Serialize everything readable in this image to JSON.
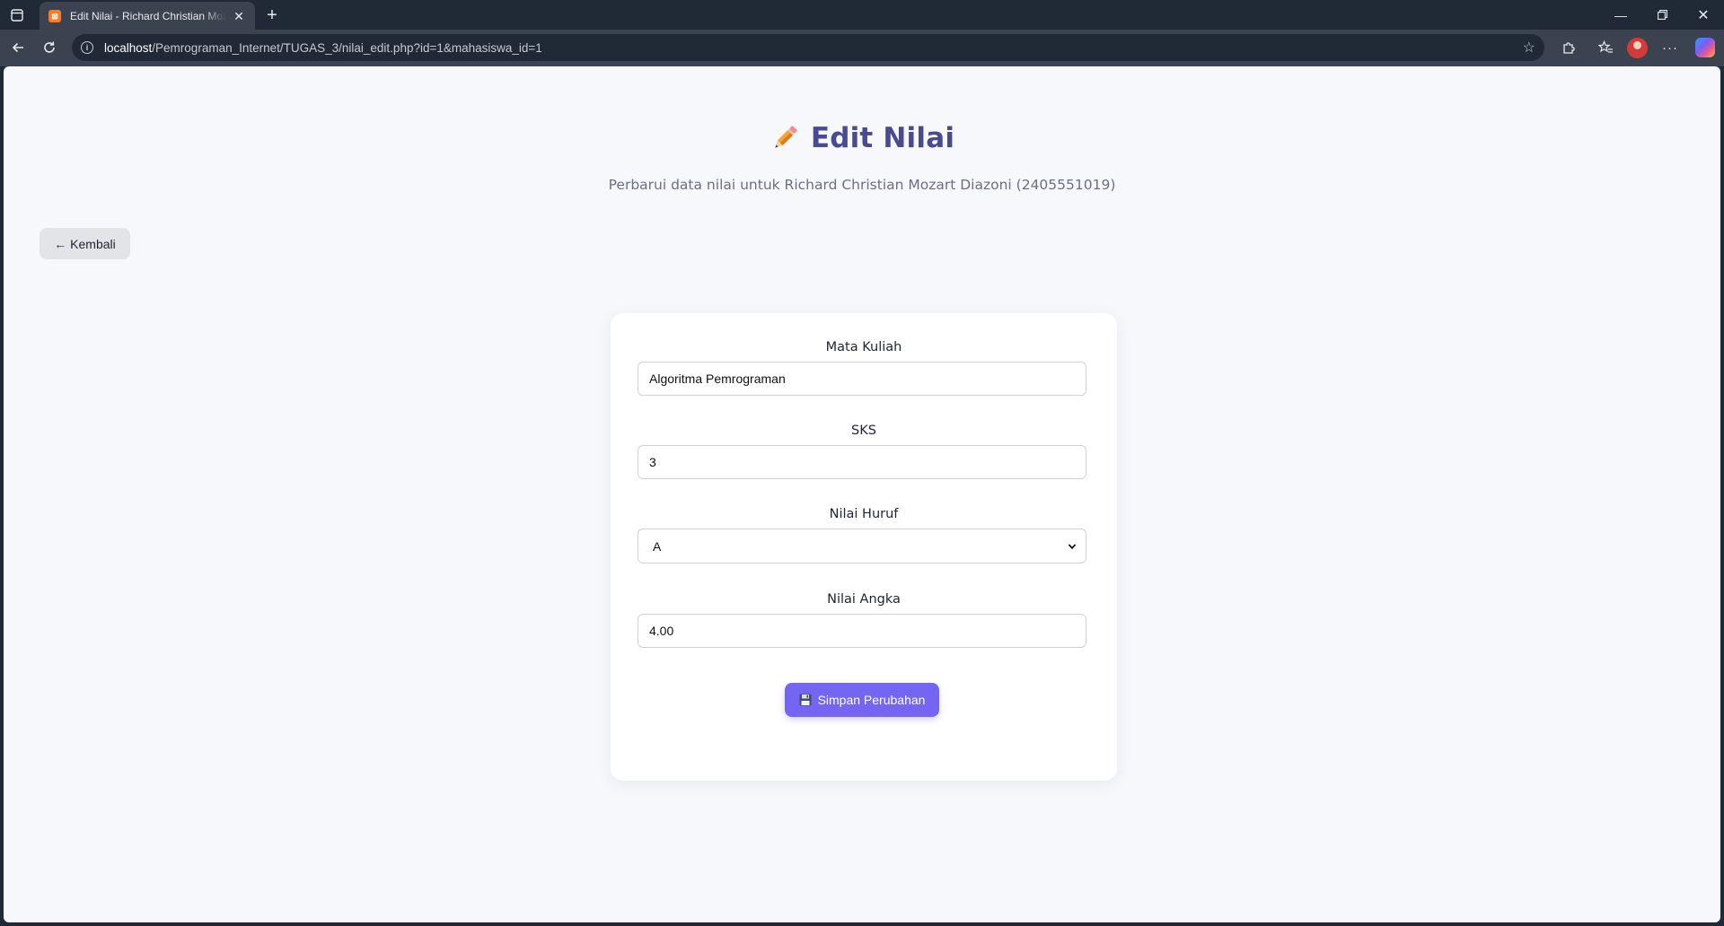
{
  "browser": {
    "tab_title": "Edit Nilai - Richard Christian Mozart Diazoni",
    "tab_favicon": "xampp-icon",
    "url_host": "localhost",
    "url_path": "/Pemrograman_Internet/TUGAS_3/nilai_edit.php?id=1&mahasiswa_id=1"
  },
  "page": {
    "title": "Edit Nilai",
    "title_icon": "pencil-icon",
    "subtitle": "Perbarui data nilai untuk Richard Christian Mozart Diazoni (2405551019)",
    "back_label": "← Kembali"
  },
  "form": {
    "mata_kuliah": {
      "label": "Mata Kuliah",
      "value": "Algoritma Pemrograman"
    },
    "sks": {
      "label": "SKS",
      "value": "3"
    },
    "nilai_huruf": {
      "label": "Nilai Huruf",
      "value": "A"
    },
    "nilai_angka": {
      "label": "Nilai Angka",
      "value": "4.00"
    },
    "submit_label": "Simpan Perubahan",
    "submit_icon": "floppy-disk-icon"
  },
  "colors": {
    "title": "#4a4a8e",
    "accent_button": "#7466f2",
    "page_background": "#f7f8fc",
    "browser_frame": "#202a37"
  }
}
